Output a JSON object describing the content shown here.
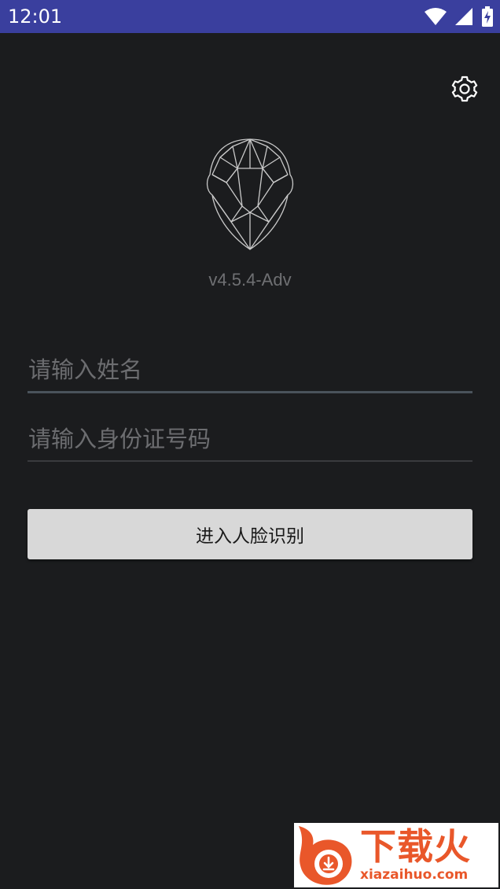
{
  "status_bar": {
    "time": "12:01",
    "icons": [
      "wifi-icon",
      "signal-icon",
      "battery-charging-icon"
    ],
    "background": "#3a3f9e"
  },
  "settings": {
    "icon": "gear-icon"
  },
  "logo": {
    "icon": "face-mesh-icon"
  },
  "version": "v4.5.4-Adv",
  "form": {
    "name_placeholder": "请输入姓名",
    "id_placeholder": "请输入身份证号码",
    "name_value": "",
    "id_value": ""
  },
  "enter_button": {
    "label": "进入人脸识别"
  },
  "watermark": {
    "brand": "下载火",
    "url": "xiazaihuo.com",
    "color": "#e9572a"
  },
  "colors": {
    "background": "#1b1c1e",
    "button": "#d8d8d8"
  }
}
